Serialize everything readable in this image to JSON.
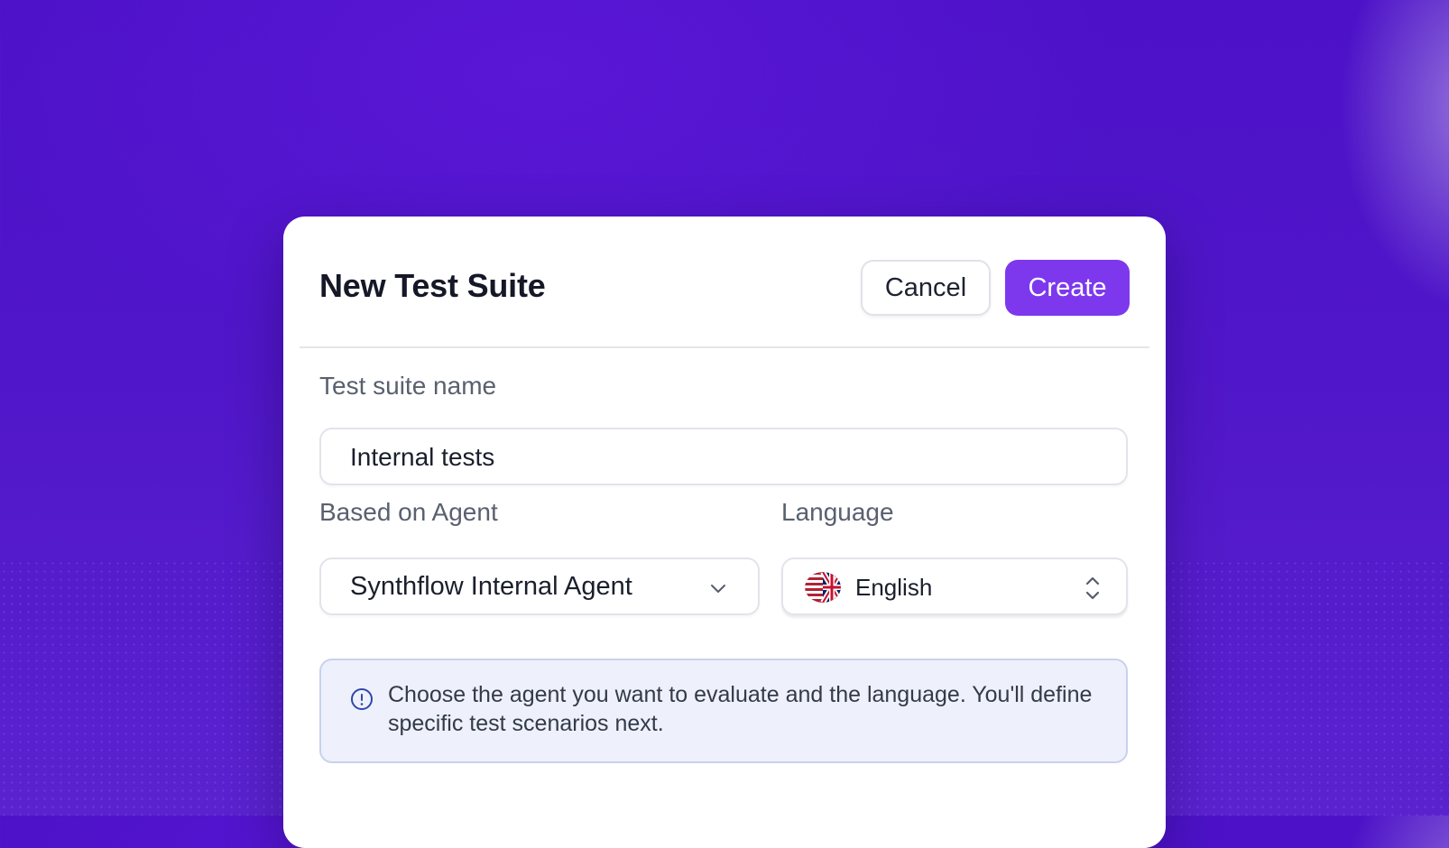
{
  "modal": {
    "title": "New Test Suite",
    "cancel_label": "Cancel",
    "create_label": "Create"
  },
  "form": {
    "name_label": "Test suite name",
    "name_value": "Internal tests",
    "agent_label": "Based on Agent",
    "agent_value": "Synthflow Internal Agent",
    "language_label": "Language",
    "language_value": "English",
    "language_flag_icon": "us-uk-flag-icon"
  },
  "info": {
    "icon": "info-icon",
    "text": "Choose the agent you want to evaluate and the language. You'll define specific test scenarios next."
  },
  "colors": {
    "background": "#5016c9",
    "accent": "#7d38ee",
    "info_bg": "#eef1fb",
    "info_border": "#c8d1ee"
  }
}
